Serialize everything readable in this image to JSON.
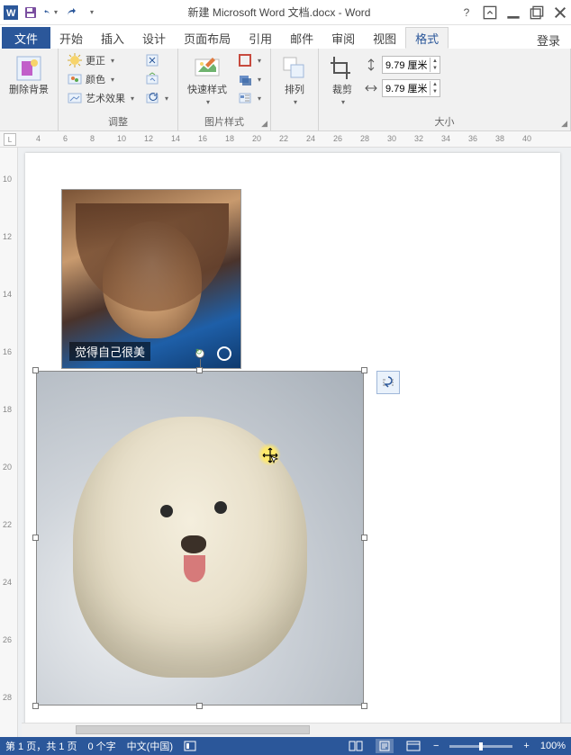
{
  "title": "新建 Microsoft Word 文档.docx - Word",
  "tabs": {
    "file": "文件",
    "home": "开始",
    "insert": "插入",
    "design": "设计",
    "layout": "页面布局",
    "references": "引用",
    "mail": "邮件",
    "review": "审阅",
    "view": "视图",
    "format": "格式",
    "login": "登录"
  },
  "ribbon": {
    "removebg": {
      "label": "删除背景"
    },
    "adjust": {
      "correct": "更正",
      "color": "颜色",
      "effects": "艺术效果",
      "group_label": "调整"
    },
    "styles": {
      "big_label": "快速样式",
      "group_label": "图片样式"
    },
    "arrange": {
      "big_label": "排列"
    },
    "crop": {
      "big_label": "裁剪"
    },
    "size": {
      "height": "9.79 厘米",
      "width": "9.79 厘米",
      "group_label": "大小"
    }
  },
  "ruler_h": [
    "4",
    "6",
    "8",
    "10",
    "12",
    "14",
    "16",
    "18",
    "20",
    "22",
    "24",
    "26",
    "28",
    "30",
    "32",
    "34",
    "36",
    "38",
    "40"
  ],
  "ruler_v": [
    "10",
    "12",
    "14",
    "16",
    "18",
    "20",
    "22",
    "24",
    "26",
    "28"
  ],
  "image1": {
    "caption": "觉得自己很美"
  },
  "status": {
    "page": "第 1 页，共 1 页",
    "words": "0 个字",
    "lang": "中文(中国)",
    "zoom": "100%"
  }
}
